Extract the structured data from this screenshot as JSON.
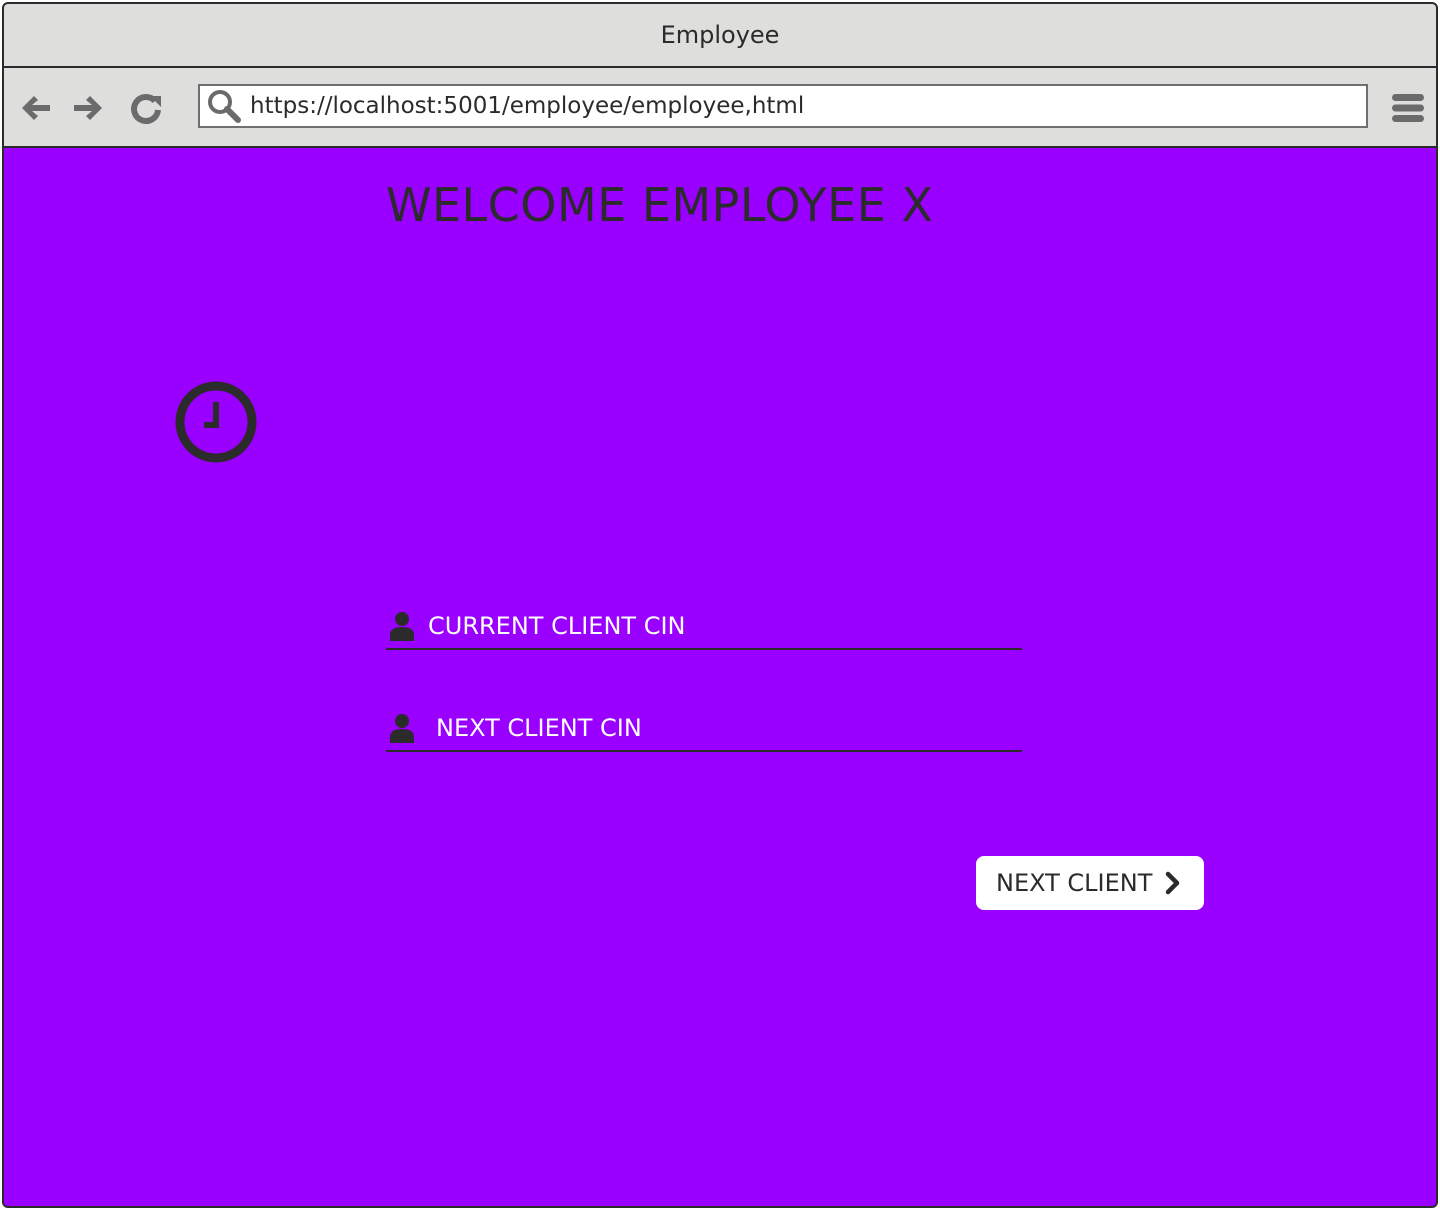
{
  "window": {
    "title": "Employee"
  },
  "browser": {
    "url": "https://localhost:5001/employee/employee,html",
    "icons": {
      "back": "arrow-left-icon",
      "forward": "arrow-right-icon",
      "reload": "reload-icon",
      "search": "search-icon",
      "menu": "hamburger-menu-icon"
    }
  },
  "page": {
    "heading": "WELCOME EMPLOYEE X",
    "clock_icon": "clock-icon",
    "fields": {
      "current_client": {
        "placeholder": "CURRENT CLIENT CIN",
        "icon": "user-icon"
      },
      "next_client": {
        "placeholder": "NEXT CLIENT CIN",
        "icon": "user-icon"
      }
    },
    "next_button": {
      "label": "NEXT CLIENT",
      "icon": "chevron-right-icon"
    }
  },
  "colors": {
    "background": "#9900ff",
    "chrome": "#dededd",
    "text_dark": "#2b2b2b",
    "field_text": "#ffffff",
    "button_bg": "#ffffff"
  }
}
